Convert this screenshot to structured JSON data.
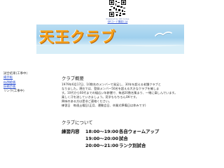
{
  "qr": {
    "caption": "Powered by QR Codes",
    "link": "QRコード機能とは"
  },
  "banner": {
    "title": "天王クラブ"
  },
  "sidebar": {
    "items": [
      {
        "label": "試合結果(工事中)",
        "link": false
      },
      {
        "label": "掲示板",
        "link": true
      },
      {
        "label": "似顔絵板",
        "link": true
      },
      {
        "label": "旧掲示板",
        "link": true
      },
      {
        "label": "リンク(工事中)",
        "link": false
      }
    ]
  },
  "overview": {
    "heading": "クラブ概要",
    "lines": [
      "1979年6月17日、10数名のメンバーで発足し、30年を超える老舗クラブと",
      "なりました。現在では、登録メンバー50名を超える大きなクラブを擁しま",
      "す。10代から60代までの幅広い年齢層で、毎週20数名集まり、一緒に楽しんでいます。",
      "楽しく汗を流していきましょう。見学ももちろんOKです。",
      "興味のある方は是非ご連絡ください。"
    ],
    "practice_line": "練習日　毎週土曜日(正月、運動会日、卒業式準備日は休みです)"
  },
  "about": {
    "heading": "クラブについて",
    "schedule_label": "練習内容",
    "rows": [
      {
        "time": "18:00～19:00",
        "activity": "各自ウォームアップ"
      },
      {
        "time": "19:00～20:00",
        "activity": "試合"
      },
      {
        "time": "20:00～21:00",
        "activity": "ランク別試合"
      }
    ]
  },
  "colors": {
    "banner_title": "#f7a21a",
    "link": "#2a4fd0"
  }
}
